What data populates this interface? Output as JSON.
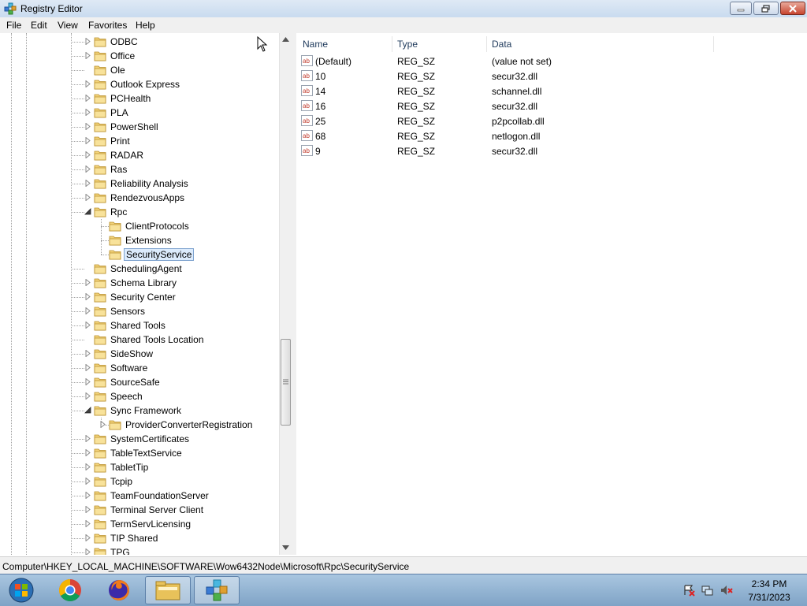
{
  "window": {
    "title": "Registry Editor"
  },
  "menu": [
    "File",
    "Edit",
    "View",
    "Favorites",
    "Help"
  ],
  "tree": {
    "items": [
      {
        "label": "ODBC",
        "level": 0,
        "expander": "collapsed"
      },
      {
        "label": "Office",
        "level": 0,
        "expander": "collapsed"
      },
      {
        "label": "Ole",
        "level": 0,
        "expander": "none"
      },
      {
        "label": "Outlook Express",
        "level": 0,
        "expander": "collapsed"
      },
      {
        "label": "PCHealth",
        "level": 0,
        "expander": "collapsed"
      },
      {
        "label": "PLA",
        "level": 0,
        "expander": "collapsed"
      },
      {
        "label": "PowerShell",
        "level": 0,
        "expander": "collapsed"
      },
      {
        "label": "Print",
        "level": 0,
        "expander": "collapsed"
      },
      {
        "label": "RADAR",
        "level": 0,
        "expander": "collapsed"
      },
      {
        "label": "Ras",
        "level": 0,
        "expander": "collapsed"
      },
      {
        "label": "Reliability Analysis",
        "level": 0,
        "expander": "collapsed"
      },
      {
        "label": "RendezvousApps",
        "level": 0,
        "expander": "collapsed"
      },
      {
        "label": "Rpc",
        "level": 0,
        "expander": "expanded"
      },
      {
        "label": "ClientProtocols",
        "level": 1,
        "expander": "none"
      },
      {
        "label": "Extensions",
        "level": 1,
        "expander": "none"
      },
      {
        "label": "SecurityService",
        "level": 1,
        "expander": "none",
        "selected": true
      },
      {
        "label": "SchedulingAgent",
        "level": 0,
        "expander": "none"
      },
      {
        "label": "Schema Library",
        "level": 0,
        "expander": "collapsed"
      },
      {
        "label": "Security Center",
        "level": 0,
        "expander": "collapsed"
      },
      {
        "label": "Sensors",
        "level": 0,
        "expander": "collapsed"
      },
      {
        "label": "Shared Tools",
        "level": 0,
        "expander": "collapsed"
      },
      {
        "label": "Shared Tools Location",
        "level": 0,
        "expander": "none"
      },
      {
        "label": "SideShow",
        "level": 0,
        "expander": "collapsed"
      },
      {
        "label": "Software",
        "level": 0,
        "expander": "collapsed"
      },
      {
        "label": "SourceSafe",
        "level": 0,
        "expander": "collapsed"
      },
      {
        "label": "Speech",
        "level": 0,
        "expander": "collapsed"
      },
      {
        "label": "Sync Framework",
        "level": 0,
        "expander": "expanded"
      },
      {
        "label": "ProviderConverterRegistration",
        "level": 1,
        "expander": "collapsed"
      },
      {
        "label": "SystemCertificates",
        "level": 0,
        "expander": "collapsed"
      },
      {
        "label": "TableTextService",
        "level": 0,
        "expander": "collapsed"
      },
      {
        "label": "TabletTip",
        "level": 0,
        "expander": "collapsed"
      },
      {
        "label": "Tcpip",
        "level": 0,
        "expander": "collapsed"
      },
      {
        "label": "TeamFoundationServer",
        "level": 0,
        "expander": "collapsed"
      },
      {
        "label": "Terminal Server Client",
        "level": 0,
        "expander": "collapsed"
      },
      {
        "label": "TermServLicensing",
        "level": 0,
        "expander": "collapsed"
      },
      {
        "label": "TIP Shared",
        "level": 0,
        "expander": "collapsed"
      },
      {
        "label": "TPG",
        "level": 0,
        "expander": "collapsed"
      }
    ]
  },
  "list": {
    "columns": [
      "Name",
      "Type",
      "Data"
    ],
    "rows": [
      {
        "name": "(Default)",
        "type": "REG_SZ",
        "data": "(value not set)"
      },
      {
        "name": "10",
        "type": "REG_SZ",
        "data": "secur32.dll"
      },
      {
        "name": "14",
        "type": "REG_SZ",
        "data": "schannel.dll"
      },
      {
        "name": "16",
        "type": "REG_SZ",
        "data": "secur32.dll"
      },
      {
        "name": "25",
        "type": "REG_SZ",
        "data": "p2pcollab.dll"
      },
      {
        "name": "68",
        "type": "REG_SZ",
        "data": "netlogon.dll"
      },
      {
        "name": "9",
        "type": "REG_SZ",
        "data": "secur32.dll"
      }
    ]
  },
  "status": {
    "path": "Computer\\HKEY_LOCAL_MACHINE\\SOFTWARE\\Wow6432Node\\Microsoft\\Rpc\\SecurityService"
  },
  "taskbar": {
    "apps": [
      "start-orb-icon",
      "chrome-icon",
      "firefox-icon",
      "file-explorer-icon",
      "registry-editor-icon"
    ],
    "active_app": "registry-editor-icon",
    "tray": [
      "action-center-icon",
      "network-icon",
      "volume-muted-icon"
    ],
    "time": "2:34 PM",
    "date": "7/31/2023"
  }
}
